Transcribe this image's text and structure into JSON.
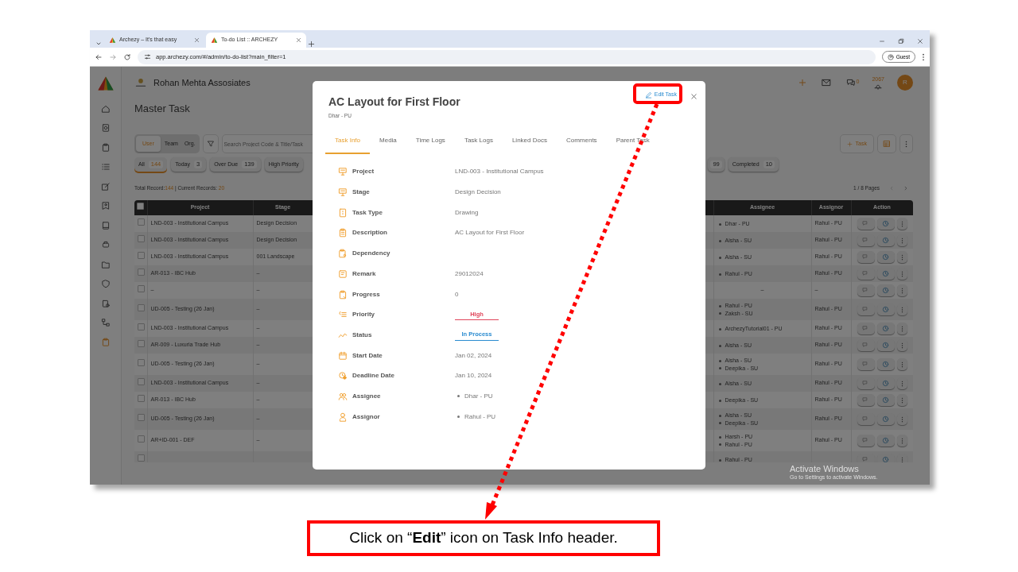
{
  "browser": {
    "tabs": [
      {
        "title": "Archezy – It's that easy",
        "selected": false
      },
      {
        "title": "To-do List :: ARCHEZY",
        "selected": true
      }
    ],
    "url": "app.archezy.com/#/admin/to-do-list?main_filter=1",
    "profile": "Guest"
  },
  "app": {
    "company": "Rohan Mehta Assosiates",
    "chat_count": "0",
    "notification_count": "2067",
    "avatar": "R",
    "page_title": "Master Task",
    "scope": [
      {
        "label": "User",
        "selected": true
      },
      {
        "label": "Team",
        "selected": false
      },
      {
        "label": "Org.",
        "selected": false
      }
    ],
    "search": {
      "placeholder": "Search Project Code & Title/Task"
    },
    "add_button": "Task",
    "filters": [
      {
        "label": "All",
        "count": "144",
        "selected": true
      },
      {
        "label": "Today",
        "count": "3",
        "selected": false
      },
      {
        "label": "Over Due",
        "count": "139",
        "selected": false
      },
      {
        "label": "High Priority",
        "selected": false
      },
      {
        "count": "99",
        "selected": false
      },
      {
        "label": "Completed",
        "count": "10",
        "selected": false
      }
    ],
    "records": {
      "total_label": "Total Record:",
      "total": "144",
      "current_label": " | Current Records: ",
      "current": "20"
    },
    "pages": "1 / 8 Pages",
    "table": {
      "all_checked": false,
      "columns": [
        "Project",
        "Stage",
        "Assignee",
        "Assignor",
        "Action"
      ],
      "rows": [
        {
          "checked": false,
          "project": "LND-003 - Institutional Campus",
          "stage": "Design Decision",
          "assignees": [
            "Dhar - PU"
          ],
          "assignor": "Rahul - PU"
        },
        {
          "checked": false,
          "project": "LND-003 - Institutional Campus",
          "stage": "Design Decision",
          "assignees": [
            "Aisha - SU"
          ],
          "assignor": "Rahul - PU"
        },
        {
          "checked": false,
          "project": "LND-003 - Institutional Campus",
          "stage": "001 Landscape",
          "assignees": [
            "Aisha - SU"
          ],
          "assignor": "Rahul - PU"
        },
        {
          "checked": false,
          "project": "AR-013 - IBC Hub",
          "stage": "–",
          "assignees": [
            "Rahul - PU"
          ],
          "assignor": "Rahul - PU"
        },
        {
          "checked": false,
          "project": "–",
          "stage": "–",
          "assignee_text": "–",
          "assignor": "–"
        },
        {
          "checked": false,
          "project": "UD-005 - Testing (26 Jan)",
          "stage": "–",
          "assignees": [
            "Rahul - PU",
            "Zaksh - SU"
          ],
          "assignor": "Rahul - PU"
        },
        {
          "checked": false,
          "project": "LND-003 - Institutional Campus",
          "stage": "–",
          "assignees": [
            "ArchezyTutorial01 - PU"
          ],
          "assignor": "Rahul - PU"
        },
        {
          "checked": false,
          "project": "AR-009 - Luxuria Trade Hub",
          "stage": "–",
          "assignees": [
            "Aisha - SU"
          ],
          "assignor": "Rahul - PU"
        },
        {
          "checked": false,
          "project": "UD-005 - Testing (26 Jan)",
          "stage": "–",
          "assignees": [
            "Aisha - SU",
            "Deepika - SU"
          ],
          "assignor": "Rahul - PU"
        },
        {
          "checked": false,
          "project": "LND-003 - Institutional Campus",
          "stage": "–",
          "assignees": [
            "Aisha - SU"
          ],
          "assignor": "Rahul - PU"
        },
        {
          "checked": false,
          "project": "AR-013 - IBC Hub",
          "stage": "–",
          "assignees": [
            "Deepika - SU"
          ],
          "assignor": "Rahul - PU"
        },
        {
          "checked": false,
          "project": "UD-005 - Testing (26 Jan)",
          "stage": "–",
          "assignees": [
            "Aisha - SU",
            "Deepika - SU"
          ],
          "assignor": "Rahul - PU"
        },
        {
          "checked": false,
          "project": "AR+ID-001 - DEF",
          "stage": "–",
          "assignees": [
            "Harsh - PU",
            "Rahul - PU"
          ],
          "assignor": "Rahul - PU"
        },
        {
          "checked": false,
          "assignees": [
            "Rahul - PU"
          ]
        }
      ]
    }
  },
  "modal": {
    "title": "AC Layout for First Floor",
    "subtitle": "Dhar - PU",
    "edit_button": "Edit Task",
    "tabs": [
      {
        "label": "Task Info",
        "selected": true
      },
      {
        "label": "Media",
        "selected": false
      },
      {
        "label": "Time Logs",
        "selected": false
      },
      {
        "label": "Task Logs",
        "selected": false
      },
      {
        "label": "Linked Docs",
        "selected": false
      },
      {
        "label": "Comments",
        "selected": false
      },
      {
        "label": "Parent Task",
        "selected": false
      }
    ],
    "fields": [
      {
        "label": "Project",
        "kind": "text",
        "value": "LND-003 - Institutional Campus"
      },
      {
        "label": "Stage",
        "kind": "text",
        "value": "Design Decision"
      },
      {
        "label": "Task Type",
        "kind": "text",
        "value": "Drawing"
      },
      {
        "label": "Description",
        "kind": "text",
        "value": "AC Layout for First Floor"
      },
      {
        "label": "Dependency",
        "kind": "text"
      },
      {
        "label": "Remark",
        "kind": "text",
        "value": "29012024"
      },
      {
        "label": "Progress",
        "kind": "text",
        "value": "0"
      },
      {
        "label": "Priority",
        "kind": "badge",
        "value": "High",
        "color": "#e0455a"
      },
      {
        "label": "Status",
        "kind": "badge",
        "value": "In Process",
        "color": "#2a8bd0"
      },
      {
        "label": "Start Date",
        "kind": "text",
        "value": "Jan 02, 2024"
      },
      {
        "label": "Deadline Date",
        "kind": "text",
        "value": "Jan 10, 2024"
      },
      {
        "label": "Assignee",
        "kind": "list",
        "items": [
          "Dhar - PU"
        ]
      },
      {
        "label": "Assignor",
        "kind": "list",
        "items": [
          "Rahul - PU"
        ]
      }
    ]
  },
  "os_notice": {
    "title": "Activate Windows",
    "text": "Go to Settings to activate Windows."
  },
  "callout": "Click on “**Edit**” icon on Task Info header."
}
